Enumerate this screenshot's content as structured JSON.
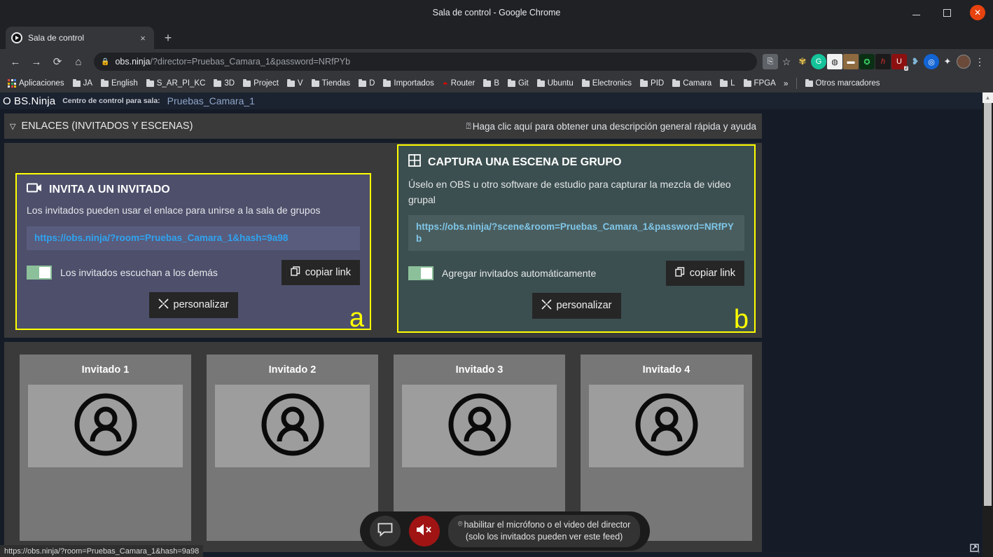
{
  "window": {
    "title": "Sala de control - Google Chrome",
    "minimize": "−",
    "maximize": "□",
    "close": "✕"
  },
  "browser": {
    "tab": {
      "title": "Sala de control",
      "close_label": "×"
    },
    "new_tab_label": "+",
    "nav": {
      "back": "←",
      "forward": "→",
      "reload": "⟳",
      "home": "⌂"
    },
    "omnibox": {
      "lock_icon": "lock-icon",
      "url_domain": "obs.ninja",
      "url_path": "/?director=Pruebas_Camara_1&password=NRfPYb",
      "full_url": "obs.ninja/?director=Pruebas_Camara_1&password=NRfPYb"
    },
    "extensions": [
      {
        "name": "translate-icon",
        "glyph": "⎘",
        "bg": "#5f6368",
        "fg": "#e8eaed"
      },
      {
        "name": "bookmark-star-icon",
        "glyph": "☆",
        "bg": "transparent",
        "fg": "#cfd2d6"
      },
      {
        "name": "honey-extension-icon",
        "glyph": "🍯",
        "bg": "transparent",
        "fg": "#e8c34a"
      },
      {
        "name": "grammarly-extension-icon",
        "glyph": "G",
        "bg": "#15c39a",
        "fg": "#ffffff"
      },
      {
        "name": "adblock-hidden-icon",
        "glyph": "◍",
        "bg": "#f1f1f1",
        "fg": "#202124"
      },
      {
        "name": "metamask-extension-icon",
        "glyph": "▮",
        "bg": "#8d6a3f",
        "fg": "#ffffff"
      },
      {
        "name": "shield-extension-icon",
        "glyph": "✪",
        "bg": "#0b2f14",
        "fg": "#3ddc6b"
      },
      {
        "name": "h-extension-icon",
        "glyph": "h",
        "bg": "#1b1b1b",
        "fg": "#e03030"
      },
      {
        "name": "ublock-origin-icon",
        "glyph": "U",
        "bg": "#8c1010",
        "fg": "#ffffff",
        "badge": "2"
      },
      {
        "name": "feather-extension-icon",
        "glyph": "❥",
        "bg": "transparent",
        "fg": "#7fb4d4"
      },
      {
        "name": "loom-extension-icon",
        "glyph": "◉",
        "bg": "#1264d4",
        "fg": "#ffffff"
      },
      {
        "name": "puzzle-extensions-icon",
        "glyph": "✦",
        "bg": "transparent",
        "fg": "#e8eaed"
      }
    ],
    "profile_label": "avatar",
    "menu_label": "⋮",
    "bookmarks": {
      "apps_label": "Aplicaciones",
      "items": [
        "JA",
        "English",
        "S_AR_PI_KC",
        "3D",
        "Project",
        "V",
        "Tiendas",
        "D",
        "Importados"
      ],
      "router_label": "Router",
      "items2": [
        "B",
        "Git",
        "Ubuntu",
        "Electronics",
        "PID",
        "Camara",
        "L",
        "FPGA"
      ],
      "overflow_label": "»",
      "other_label": "Otros marcadores"
    }
  },
  "site": {
    "logo": "O BS.Ninja",
    "subtitle": "Centro de control para sala:",
    "room": "Pruebas_Camara_1"
  },
  "links_bar": {
    "caret": "▽",
    "title": "ENLACES (INVITADOS Y ESCENAS)",
    "help_icon": "question-circle-icon",
    "help_text": "Haga clic aquí para obtener una descripción general rápida y ayuda"
  },
  "cards": [
    {
      "id": "invite-guest",
      "icon": "video-camera-icon",
      "title": "INVITA A UN INVITADO",
      "description": "Los invitados pueden usar el enlace para unirse a la sala de grupos",
      "link": "https://obs.ninja/?room=Pruebas_Camara_1&hash=9a98",
      "toggle_label": "Los invitados escuchan a los demás",
      "toggle_state": "on",
      "copy_label": "copiar link",
      "copy_icon": "copy-icon",
      "customize_label": "personalizar",
      "customize_icon": "tools-icon",
      "corner_letter": "a",
      "accent": "#ffff00",
      "bg": "#4d4f6b"
    },
    {
      "id": "group-scene",
      "icon": "grid-icon",
      "title": "CAPTURA UNA ESCENA DE GRUPO",
      "description": "Úselo en OBS u otro software de estudio para capturar la mezcla de video grupal",
      "link": "https://obs.ninja/?scene&room=Pruebas_Camara_1&password=NRfPYb",
      "toggle_label": "Agregar invitados automáticamente",
      "toggle_state": "on",
      "copy_label": "copiar link",
      "copy_icon": "copy-icon",
      "customize_label": "personalizar",
      "customize_icon": "tools-icon",
      "corner_letter": "b",
      "accent": "#ffff00",
      "bg": "#3c4f50"
    }
  ],
  "guests": [
    {
      "name": "Invitado 1",
      "avatar": "person-placeholder-icon"
    },
    {
      "name": "Invitado 2",
      "avatar": "person-placeholder-icon"
    },
    {
      "name": "Invitado 3",
      "avatar": "person-placeholder-icon"
    },
    {
      "name": "Invitado 4",
      "avatar": "person-placeholder-icon"
    }
  ],
  "control_bar": {
    "chat_icon": "chat-bubble-icon",
    "mute_icon": "speaker-muted-icon",
    "note_icon": "headphone-icon",
    "note_line1": "habilitar el micrófono o el video del director",
    "note_line2": "(solo los invitados pueden ver este feed)"
  },
  "status_bar": {
    "url": "https://obs.ninja/?room=Pruebas_Camara_1&hash=9a98"
  },
  "scrollbar": {
    "up": "▲",
    "down": "▼"
  },
  "corner_badge": "screen-share-icon"
}
